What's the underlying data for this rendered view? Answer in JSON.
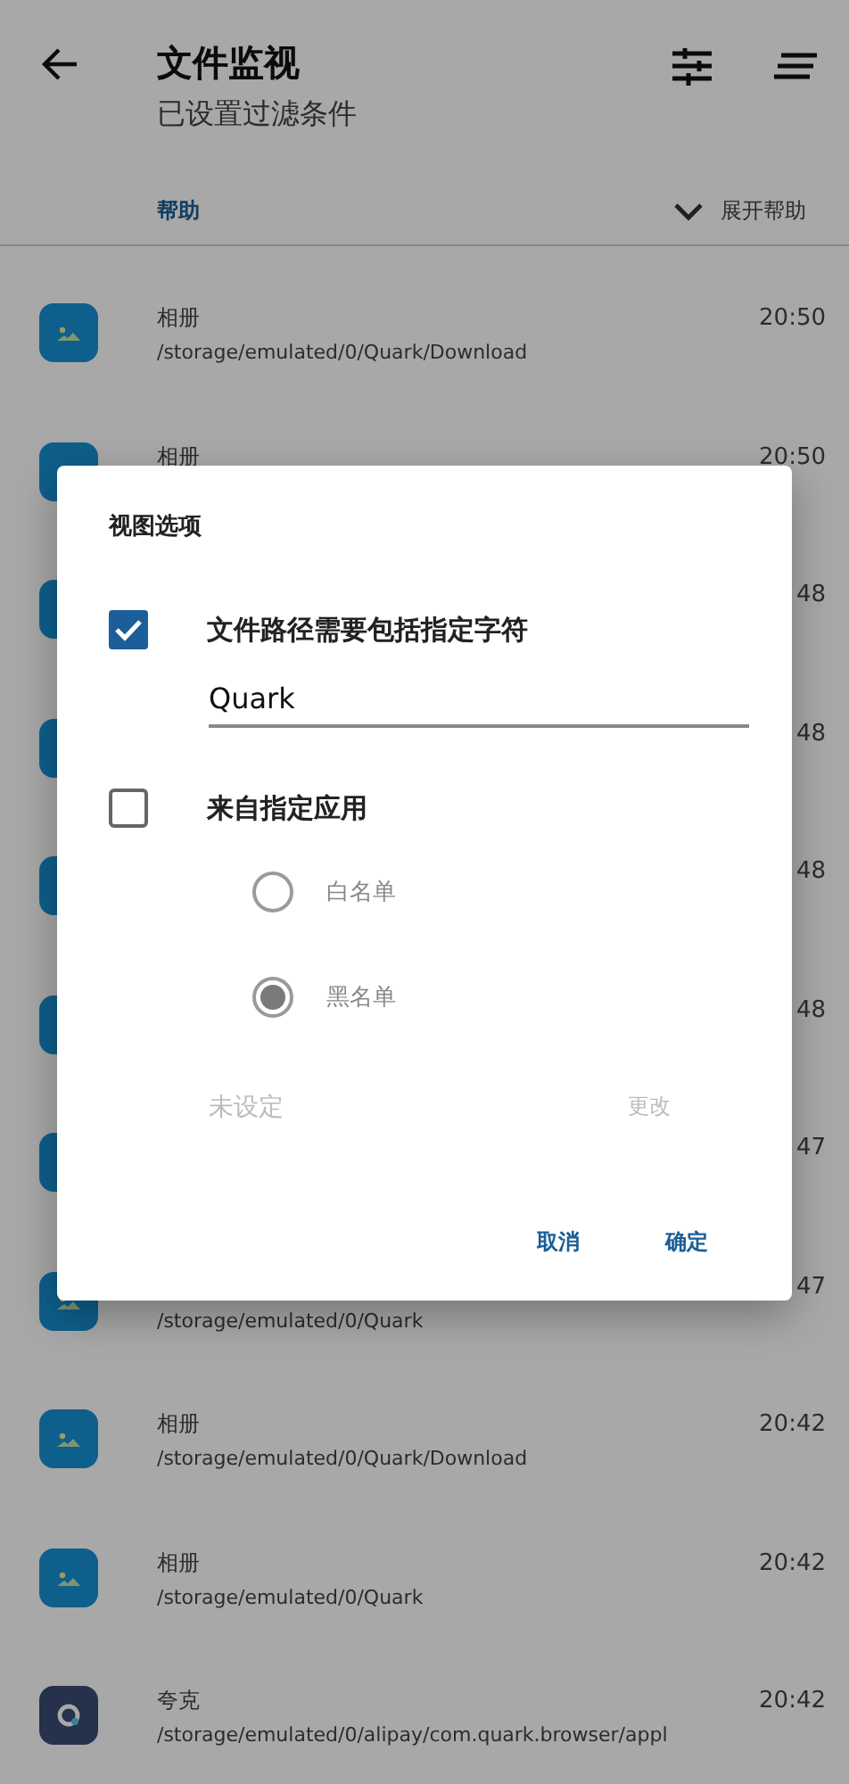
{
  "app_bar": {
    "title": "文件监视",
    "subtitle": "已设置过滤条件"
  },
  "help": {
    "label": "帮助",
    "toggle": "展开帮助",
    "expanded": false
  },
  "records": [
    {
      "kind": "gallery",
      "app": "相册",
      "path": "/storage/emulated/0/Quark/Download",
      "time": "20:50"
    },
    {
      "kind": "gallery",
      "app": "相册",
      "time": "20:50"
    },
    {
      "kind": "gallery",
      "time": "48"
    },
    {
      "kind": "gallery",
      "time": "48"
    },
    {
      "kind": "gallery",
      "time": "48"
    },
    {
      "kind": "gallery",
      "time": "48"
    },
    {
      "kind": "gallery",
      "time": "47"
    },
    {
      "kind": "gallery",
      "path": "/storage/emulated/0/Quark",
      "time": "47"
    },
    {
      "kind": "gallery",
      "app": "相册",
      "path": "/storage/emulated/0/Quark/Download",
      "time": "20:42"
    },
    {
      "kind": "gallery",
      "app": "相册",
      "path": "/storage/emulated/0/Quark",
      "time": "20:42"
    },
    {
      "kind": "browser",
      "app": "夸克",
      "path": "/storage/emulated/0/alipay/com.quark.browser/appl",
      "time": "20:42"
    }
  ],
  "dialog": {
    "title": "视图选项",
    "path_filter": {
      "label": "文件路径需要包括指定字符",
      "checked": true,
      "value": "Quark"
    },
    "app_filter": {
      "label": "来自指定应用",
      "checked": false,
      "disabled": true,
      "modes": [
        {
          "label": "白名单",
          "selected": false
        },
        {
          "label": "黑名单",
          "selected": true
        }
      ],
      "app_value": "未设定",
      "change": "更改"
    },
    "buttons": [
      "取消",
      "确定"
    ]
  }
}
